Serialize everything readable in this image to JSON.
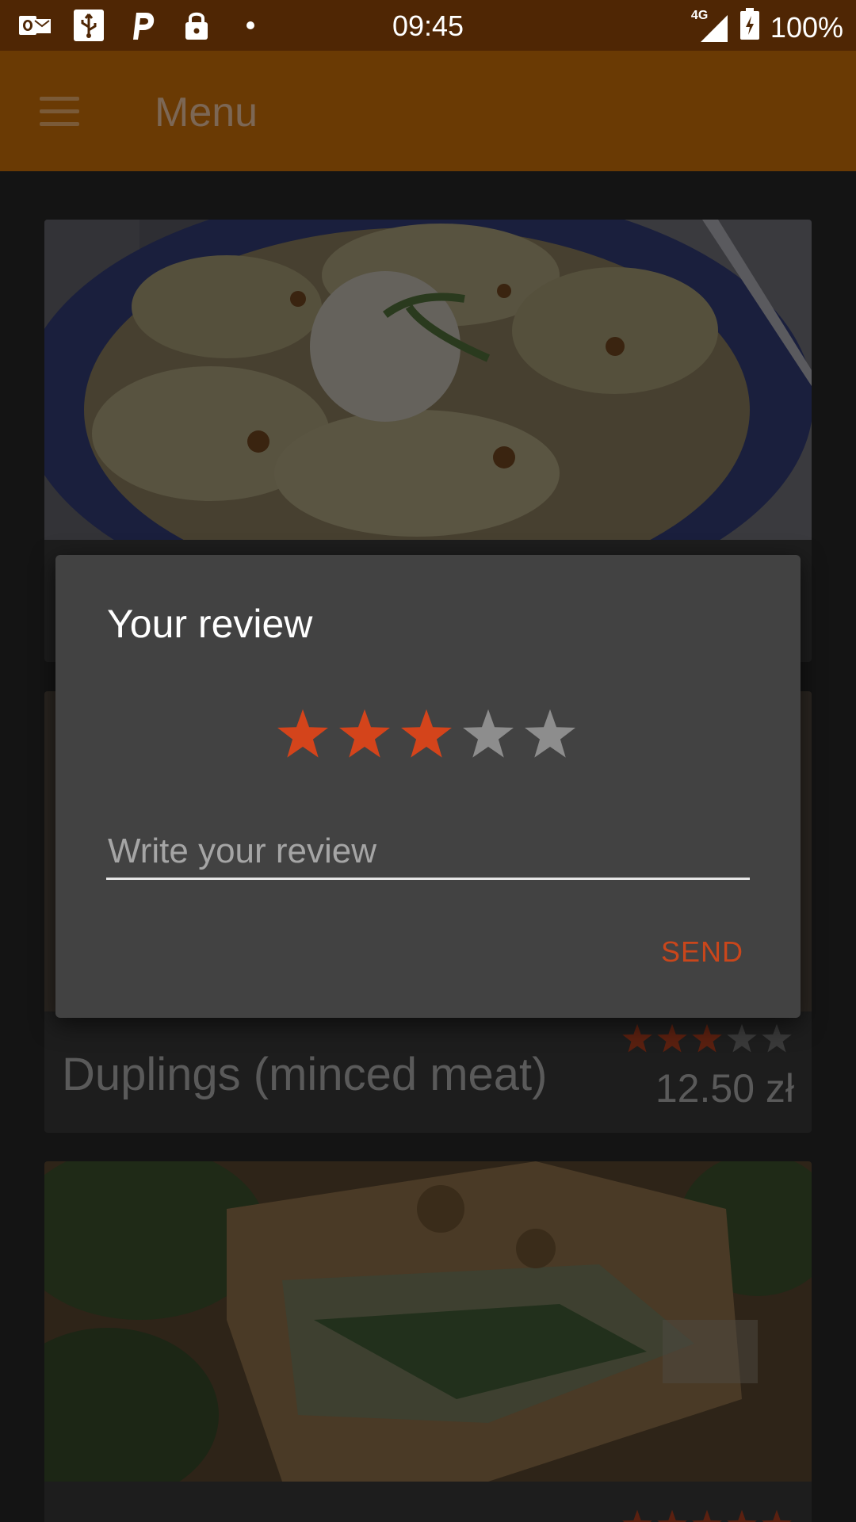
{
  "status_bar": {
    "time": "09:45",
    "network": "4G",
    "battery": "100%",
    "left_icons": [
      "outlook-icon",
      "usb-icon",
      "parking-icon",
      "lock-icon",
      "dot-icon"
    ]
  },
  "app_bar": {
    "title": "Menu"
  },
  "dishes": [
    {
      "name": "",
      "price": "",
      "rating": 0
    },
    {
      "name": "Duplings (minced meat)",
      "price": "12.50 zł",
      "rating": 3
    },
    {
      "name": "",
      "price": "",
      "rating": 5
    }
  ],
  "dialog": {
    "title": "Your review",
    "rating": 3,
    "max_rating": 5,
    "input_placeholder": "Write your review",
    "input_value": "",
    "send_label": "SEND"
  },
  "colors": {
    "status_bar_bg": "#4f2604",
    "app_bar_bg": "#6a3a04",
    "accent": "#d4441b",
    "dialog_bg": "#424242",
    "star_inactive": "#8d8d8d"
  }
}
